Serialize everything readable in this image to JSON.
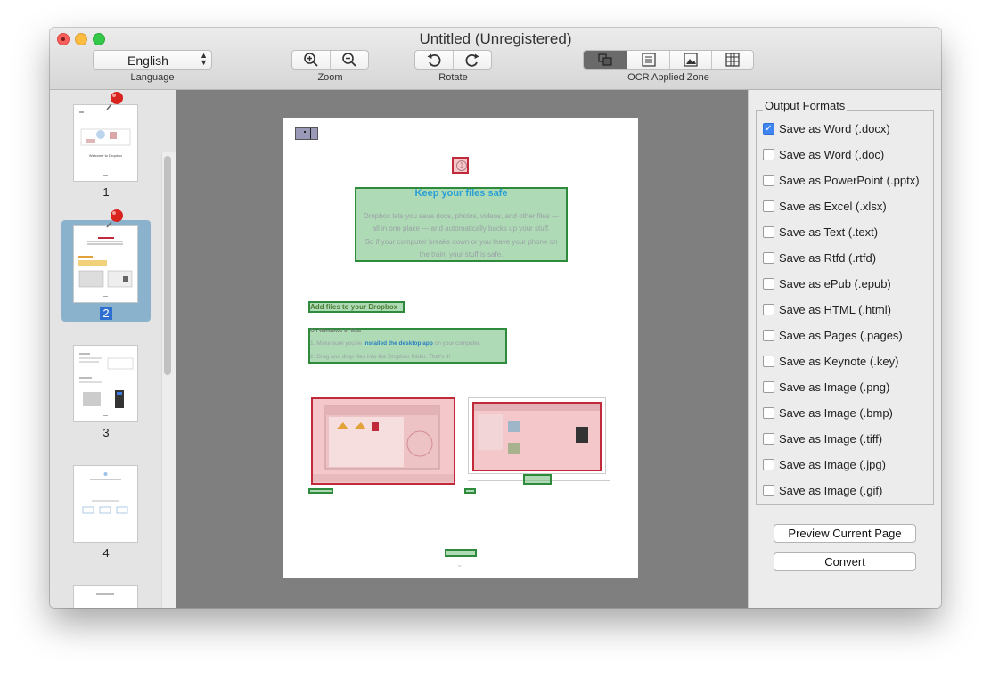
{
  "window": {
    "title": "Untitled (Unregistered)"
  },
  "toolbar": {
    "language": {
      "value": "English",
      "label": "Language"
    },
    "zoom_label": "Zoom",
    "rotate_label": "Rotate",
    "ocr_zone_label": "OCR Applied Zone",
    "icons": [
      "zoom-in-icon",
      "zoom-out-icon",
      "rotate-left-icon",
      "rotate-right-icon",
      "zone-mixed-icon",
      "zone-text-icon",
      "zone-image-icon",
      "zone-table-icon"
    ]
  },
  "sidebar": {
    "pages": [
      {
        "number": "1",
        "caption": "Welcome to Dropbox",
        "pinned": true,
        "selected": false
      },
      {
        "number": "2",
        "pinned": true,
        "selected": true
      },
      {
        "number": "3",
        "pinned": false,
        "selected": false
      },
      {
        "number": "4",
        "pinned": false,
        "selected": false
      }
    ]
  },
  "document": {
    "page_badge": "1",
    "heading": "Keep your files safe",
    "body_lines": [
      "Dropbox lets you save docs, photos, videos, and other files —",
      "all in one place — and automatically backs up your stuff.",
      "So if your computer breaks down or you leave your phone on",
      "the train, your stuff is safe."
    ],
    "subheading": "Add files to your Dropbox",
    "section_title": "On Windows or Mac",
    "steps": [
      {
        "prefix": "1.  Make sure you've ",
        "link": "installed the desktop app",
        "suffix": " on your computer."
      },
      {
        "prefix": "2.  Drag and drop files into the Dropbox folder. That's it!",
        "link": "",
        "suffix": ""
      }
    ]
  },
  "output_panel": {
    "title": "Output Formats",
    "formats": [
      {
        "label": "Save as Word (.docx)",
        "checked": true
      },
      {
        "label": "Save as Word (.doc)",
        "checked": false
      },
      {
        "label": "Save as PowerPoint (.pptx)",
        "checked": false
      },
      {
        "label": "Save as Excel (.xlsx)",
        "checked": false
      },
      {
        "label": "Save as Text (.text)",
        "checked": false
      },
      {
        "label": "Save as Rtfd (.rtfd)",
        "checked": false
      },
      {
        "label": "Save as ePub (.epub)",
        "checked": false
      },
      {
        "label": "Save as HTML (.html)",
        "checked": false
      },
      {
        "label": "Save as Pages (.pages)",
        "checked": false
      },
      {
        "label": "Save as Keynote (.key)",
        "checked": false
      },
      {
        "label": "Save as Image (.png)",
        "checked": false
      },
      {
        "label": "Save as Image (.bmp)",
        "checked": false
      },
      {
        "label": "Save as Image (.tiff)",
        "checked": false
      },
      {
        "label": "Save as Image (.jpg)",
        "checked": false
      },
      {
        "label": "Save as Image (.gif)",
        "checked": false
      }
    ],
    "preview_button": "Preview Current Page",
    "convert_button": "Convert"
  },
  "colors": {
    "text_zone": "#2e8b3c",
    "image_zone": "#c02a3a",
    "accent": "#3f86f2",
    "heading": "#2a9fd6"
  }
}
